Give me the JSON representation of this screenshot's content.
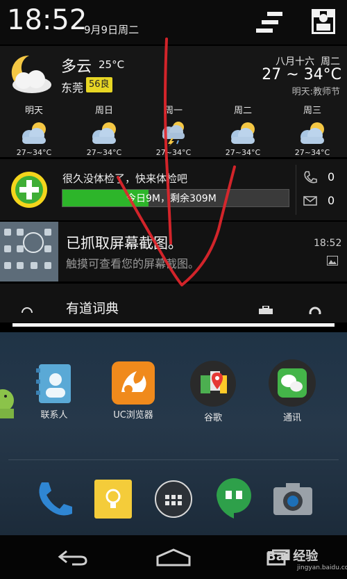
{
  "status": {
    "time": "18:52",
    "date": "9月9日周二"
  },
  "weather": {
    "condition": "多云",
    "temperature": "25°C",
    "city": "东莞",
    "aqi": "56良",
    "lunar": "八月十六  周二",
    "range": "27 ~ 34°C",
    "holiday": "明天:教师节",
    "forecast": [
      {
        "day": "明天",
        "temp": "27~34°C",
        "icon": "partly-cloudy-icon"
      },
      {
        "day": "周日",
        "temp": "27~34°C",
        "icon": "partly-cloudy-icon"
      },
      {
        "day": "周一",
        "temp": "27~34°C",
        "icon": "thunderstorm-icon"
      },
      {
        "day": "周二",
        "temp": "27~34°C",
        "icon": "partly-cloudy-icon"
      },
      {
        "day": "周三",
        "temp": "27~34°C",
        "icon": "partly-cloudy-icon"
      }
    ]
  },
  "security": {
    "message": "很久没体检了，快来体检吧",
    "bar_text": "今日9M，剩余309M",
    "bar_fill": 0.38,
    "calls": "0",
    "messages": "0"
  },
  "screenshot": {
    "title": "已抓取屏幕截图。",
    "subtitle": "触摸可查看您的屏幕截图。",
    "time": "18:52"
  },
  "youdao": {
    "title": "有道词典"
  },
  "apps": [
    {
      "label": "联系人",
      "icon": "contacts-icon"
    },
    {
      "label": "UC浏览器",
      "icon": "uc-browser-icon"
    },
    {
      "label": "谷歌",
      "icon": "google-maps-icon"
    },
    {
      "label": "通讯",
      "icon": "wechat-icon"
    }
  ],
  "watermark": {
    "brand": "Bai 经验",
    "site": "jingyan.baidu.com"
  }
}
